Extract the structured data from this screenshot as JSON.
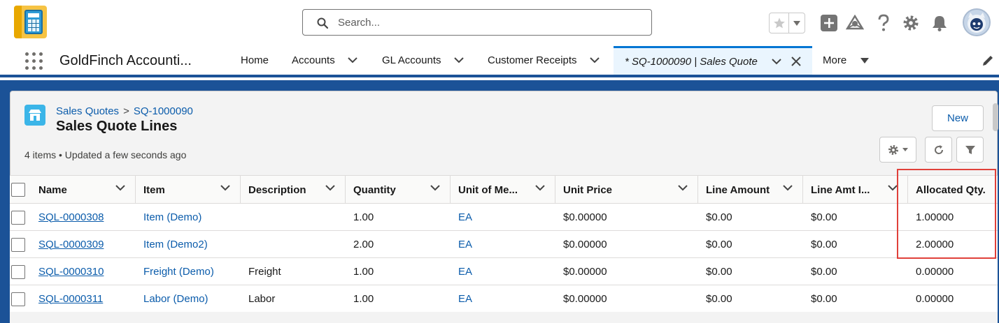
{
  "header": {
    "search_placeholder": "Search...",
    "icons": [
      "app-logo",
      "search-icon",
      "star-icon",
      "chevron-down-icon",
      "plus-icon",
      "trailhead-icon",
      "help-icon",
      "gear-icon",
      "bell-icon",
      "avatar"
    ]
  },
  "nav": {
    "app_name": "GoldFinch Accounti...",
    "items": [
      {
        "label": "Home"
      },
      {
        "label": "Accounts"
      },
      {
        "label": "GL Accounts"
      },
      {
        "label": "Customer Receipts"
      }
    ],
    "active_tab": {
      "label": "* SQ-1000090 | Sales Quote"
    },
    "more_label": "More"
  },
  "list_view": {
    "breadcrumb_parent": "Sales Quotes",
    "breadcrumb_separator": ">",
    "breadcrumb_record": "SQ-1000090",
    "title": "Sales Quote Lines",
    "meta": "4 items • Updated a few seconds ago",
    "new_button": "New"
  },
  "table": {
    "columns": [
      "Name",
      "Item",
      "Description",
      "Quantity",
      "Unit of Me...",
      "Unit Price",
      "Line Amount",
      "Line Amt I...",
      "Allocated Qty."
    ],
    "rows": [
      {
        "name": "SQL-0000308",
        "item": "Item (Demo)",
        "description": "",
        "quantity": "1.00",
        "uom": "EA",
        "unit_price": "$0.00000",
        "line_amount": "$0.00",
        "line_amt_i": "$0.00",
        "allocated_qty": "1.00000"
      },
      {
        "name": "SQL-0000309",
        "item": "Item (Demo2)",
        "description": "",
        "quantity": "2.00",
        "uom": "EA",
        "unit_price": "$0.00000",
        "line_amount": "$0.00",
        "line_amt_i": "$0.00",
        "allocated_qty": "2.00000"
      },
      {
        "name": "SQL-0000310",
        "item": "Freight (Demo)",
        "description": "Freight",
        "quantity": "1.00",
        "uom": "EA",
        "unit_price": "$0.00000",
        "line_amount": "$0.00",
        "line_amt_i": "$0.00",
        "allocated_qty": "0.00000"
      },
      {
        "name": "SQL-0000311",
        "item": "Labor (Demo)",
        "description": "Labor",
        "quantity": "1.00",
        "uom": "EA",
        "unit_price": "$0.00000",
        "line_amount": "$0.00",
        "line_amt_i": "$0.00",
        "allocated_qty": "0.00000"
      }
    ]
  },
  "colors": {
    "brand_blue": "#1b5297",
    "link": "#0b5cab",
    "highlight_box": "#e0403a",
    "active_tab_bg": "#eaf5fe"
  }
}
